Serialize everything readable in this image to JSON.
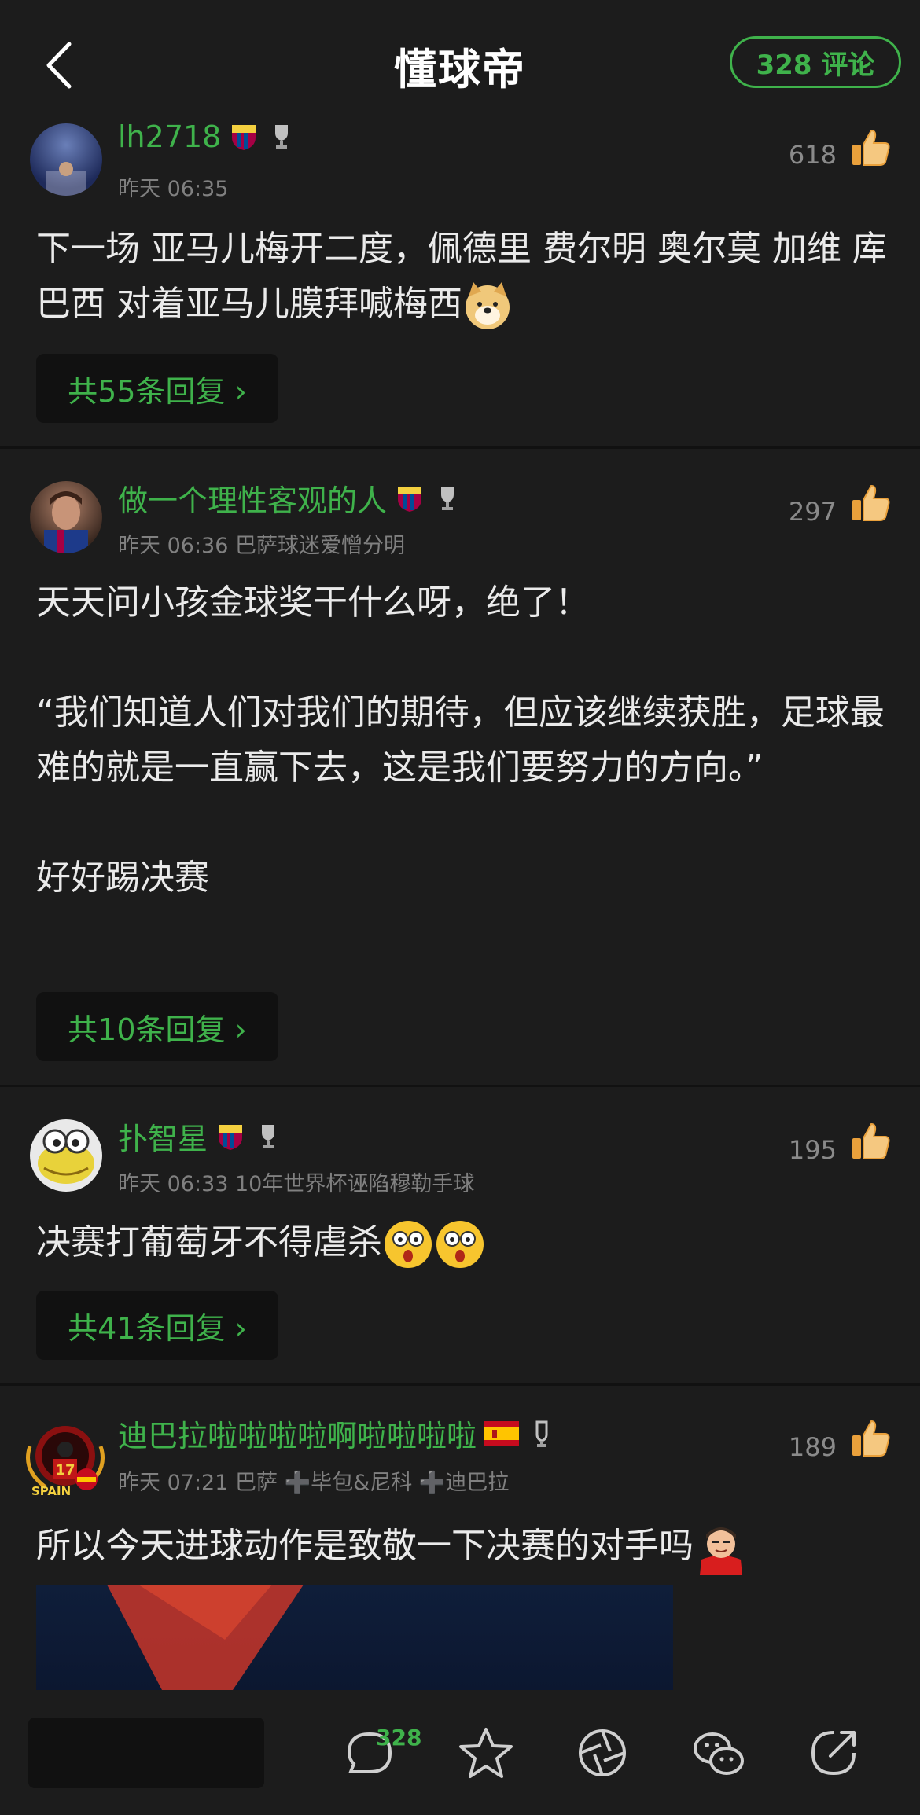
{
  "header": {
    "title": "懂球帝",
    "comment_count_label": "328 评论"
  },
  "comments": [
    {
      "username": "lh2718",
      "time": "昨天 06:35",
      "likes": "618",
      "body": "下一场 亚马儿梅开二度，佩德里 费尔明 奥尔莫 加维 库巴西 对着亚马儿膜拜喊梅西",
      "replies": "共55条回复 ›"
    },
    {
      "username": "做一个理性客观的人",
      "time": "昨天 06:36 巴萨球迷爱憎分明",
      "likes": "297",
      "body": "天天问小孩金球奖干什么呀，绝了！\n\n“我们知道人们对我们的期待，但应该继续获胜，足球最难的就是一直赢下去，这是我们要努力的方向。”\n\n好好踢决赛",
      "replies": "共10条回复 ›"
    },
    {
      "username": "扑智星",
      "time": "昨天 06:33 10年世界杯诬陷穆勒手球",
      "likes": "195",
      "body": "决赛打葡萄牙不得虐杀",
      "replies": "共41条回复 ›"
    },
    {
      "username": "迪巴拉啦啦啦啦啊啦啦啦啦",
      "time": "昨天 07:21 巴萨 ➕毕包&尼科 ➕迪巴拉",
      "likes": "189",
      "body": "所以今天进球动作是致敬一下决赛的对手吗",
      "avatar_text": "SPAIN"
    }
  ],
  "bottom_bar": {
    "comment_count": "328",
    "icons": [
      "comment-icon",
      "star-icon",
      "shutter-icon",
      "wechat-icon",
      "share-icon"
    ]
  },
  "colors": {
    "accent": "#3fb24b",
    "background": "#1c1c1c"
  }
}
